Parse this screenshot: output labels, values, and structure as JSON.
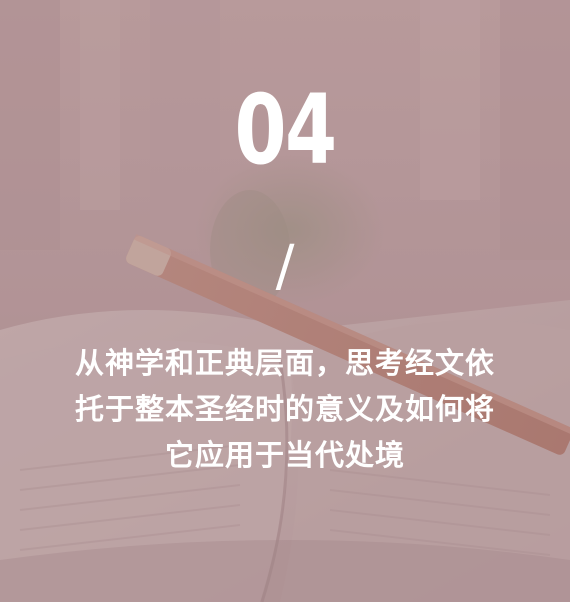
{
  "number": "04",
  "separator": "/",
  "caption_lines": [
    "从神学和正典层面，思考经文依",
    "托于整本圣经时的意义及如何将",
    "它应用于当代处境"
  ],
  "colors": {
    "text": "#ffffff",
    "overlay": "#96707a"
  }
}
